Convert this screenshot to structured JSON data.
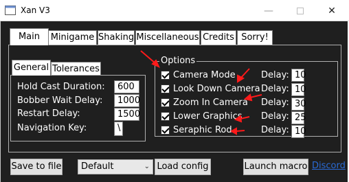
{
  "window": {
    "title": "Xan V3",
    "icon": "app-icon"
  },
  "tabs": [
    "Main",
    "Minigame",
    "Shaking",
    "Miscellaneous",
    "Credits",
    "Sorry!"
  ],
  "subtabs": [
    "General",
    "Tolerances"
  ],
  "general": {
    "hold_cast_label": "Hold Cast Duration:",
    "hold_cast_value": "600",
    "bobber_label": "Bobber Wait Delay:",
    "bobber_value": "1000",
    "restart_label": "Restart Delay:",
    "restart_value": "1500",
    "nav_key_label": "Navigation Key:",
    "nav_key_value": "\\"
  },
  "options": {
    "title": "Options",
    "delay_label": "Delay:",
    "items": [
      {
        "label": "Camera Mode",
        "checked": true,
        "delay": "10"
      },
      {
        "label": "Look Down Camera",
        "checked": true,
        "delay": "10"
      },
      {
        "label": "Zoom In Camera",
        "checked": true,
        "delay": "30"
      },
      {
        "label": "Lower Graphics",
        "checked": true,
        "delay": "25"
      },
      {
        "label": "Seraphic Rod",
        "checked": true,
        "delay": "10"
      }
    ]
  },
  "footer": {
    "save_label": "Save to file",
    "config_selected": "Default",
    "load_label": "Load config",
    "launch_label": "Launch macro",
    "discord_label": "Discord"
  },
  "colors": {
    "background": "#1f1f1f",
    "annotation": "#ff1a1a",
    "link": "#2a6bd6"
  }
}
